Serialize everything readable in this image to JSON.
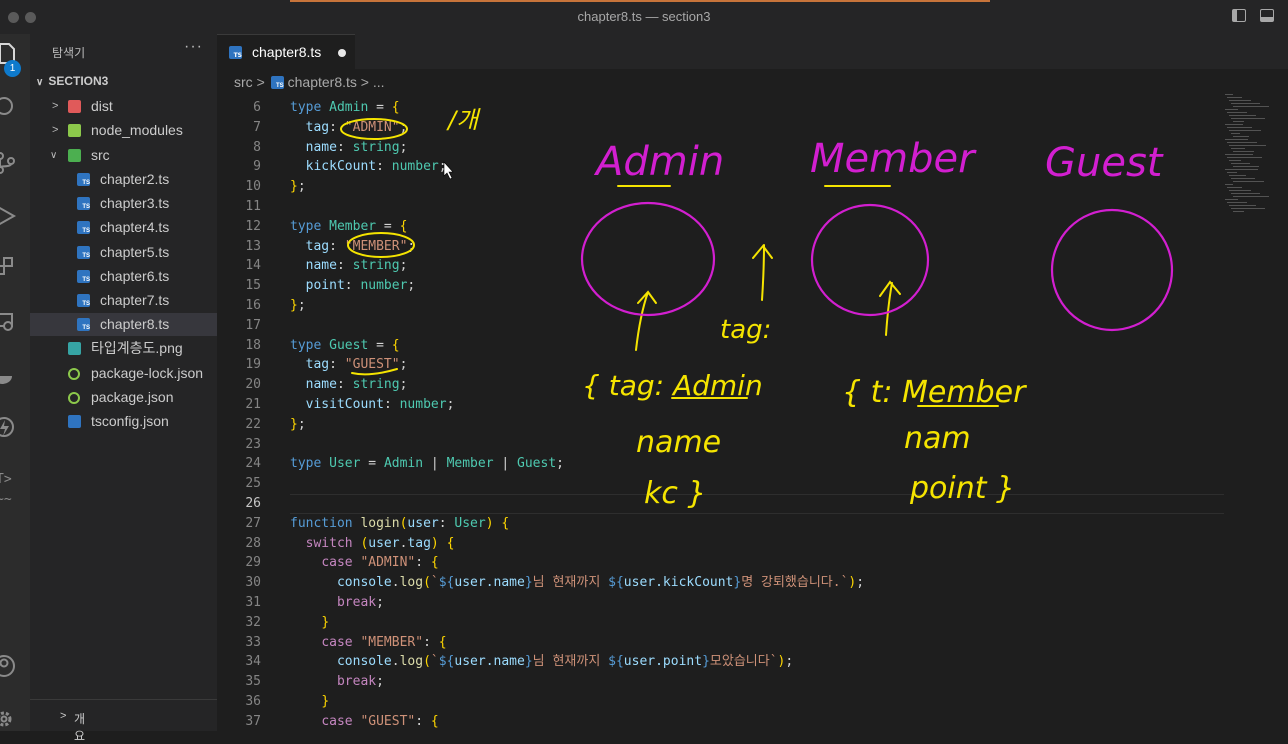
{
  "window": {
    "title": "chapter8.ts — section3"
  },
  "activity_bar": {
    "badge": "1"
  },
  "sidebar": {
    "title": "탐색기",
    "more": "···",
    "section": "SECTION3",
    "items": [
      {
        "label": "dist",
        "kind": "folder",
        "state": "collapsed"
      },
      {
        "label": "node_modules",
        "kind": "folder",
        "state": "collapsed"
      },
      {
        "label": "src",
        "kind": "folder",
        "state": "expanded"
      },
      {
        "label": "chapter2.ts",
        "kind": "ts"
      },
      {
        "label": "chapter3.ts",
        "kind": "ts"
      },
      {
        "label": "chapter4.ts",
        "kind": "ts"
      },
      {
        "label": "chapter5.ts",
        "kind": "ts"
      },
      {
        "label": "chapter6.ts",
        "kind": "ts"
      },
      {
        "label": "chapter7.ts",
        "kind": "ts"
      },
      {
        "label": "chapter8.ts",
        "kind": "ts",
        "active": true
      },
      {
        "label": "타입계층도.png",
        "kind": "png"
      },
      {
        "label": "package-lock.json",
        "kind": "json"
      },
      {
        "label": "package.json",
        "kind": "json"
      },
      {
        "label": "tsconfig.json",
        "kind": "tsconfig"
      }
    ],
    "footer": "개요"
  },
  "tab": {
    "label": "chapter8.ts",
    "modified": true
  },
  "breadcrumb": {
    "folder": "src",
    "sep": ">",
    "file": "chapter8.ts",
    "rest": "> ..."
  },
  "code_lines": [
    {
      "n": "6",
      "text": "type Admin = {"
    },
    {
      "n": "7",
      "text": "  tag: \"ADMIN\";"
    },
    {
      "n": "8",
      "text": "  name: string;"
    },
    {
      "n": "9",
      "text": "  kickCount: number;"
    },
    {
      "n": "10",
      "text": "};"
    },
    {
      "n": "11",
      "text": ""
    },
    {
      "n": "12",
      "text": "type Member = {"
    },
    {
      "n": "13",
      "text": "  tag: \"MEMBER\";"
    },
    {
      "n": "14",
      "text": "  name: string;"
    },
    {
      "n": "15",
      "text": "  point: number;"
    },
    {
      "n": "16",
      "text": "};"
    },
    {
      "n": "17",
      "text": ""
    },
    {
      "n": "18",
      "text": "type Guest = {"
    },
    {
      "n": "19",
      "text": "  tag: \"GUEST\";"
    },
    {
      "n": "20",
      "text": "  name: string;"
    },
    {
      "n": "21",
      "text": "  visitCount: number;"
    },
    {
      "n": "22",
      "text": "};"
    },
    {
      "n": "23",
      "text": ""
    },
    {
      "n": "24",
      "text": "type User = Admin | Member | Guest;"
    },
    {
      "n": "25",
      "text": ""
    },
    {
      "n": "26",
      "text": ""
    },
    {
      "n": "27",
      "text": "function login(user: User) {"
    },
    {
      "n": "28",
      "text": "  switch (user.tag) {"
    },
    {
      "n": "29",
      "text": "    case \"ADMIN\": {"
    },
    {
      "n": "30",
      "text": "      console.log(`${user.name}님 현재까지 ${user.kickCount}명 강퇴했습니다.`);"
    },
    {
      "n": "31",
      "text": "      break;"
    },
    {
      "n": "32",
      "text": "    }"
    },
    {
      "n": "33",
      "text": "    case \"MEMBER\": {"
    },
    {
      "n": "34",
      "text": "      console.log(`${user.name}님 현재까지 ${user.point}모았습니다`);"
    },
    {
      "n": "35",
      "text": "      break;"
    },
    {
      "n": "36",
      "text": "    }"
    },
    {
      "n": "37",
      "text": "    case \"GUEST\": {"
    }
  ],
  "annotations": {
    "top_note": "/개",
    "admin": "Admin",
    "member": "Member",
    "guest": "Guest",
    "tag": "tag:",
    "admin_obj_1": "{ tag: Admin",
    "admin_obj_2": "name",
    "admin_obj_3": "kc }",
    "member_obj_1": "{ t: Member",
    "member_obj_2": "nam",
    "member_obj_3": "point }"
  },
  "colors": {
    "keyword": "#569cd6",
    "type": "#4ec9b0",
    "string": "#ce9178",
    "property": "#9cdcfe",
    "function": "#dcdcaa",
    "control": "#c586c0",
    "ink_yellow": "#f5e400",
    "ink_magenta": "#d21fd0"
  }
}
